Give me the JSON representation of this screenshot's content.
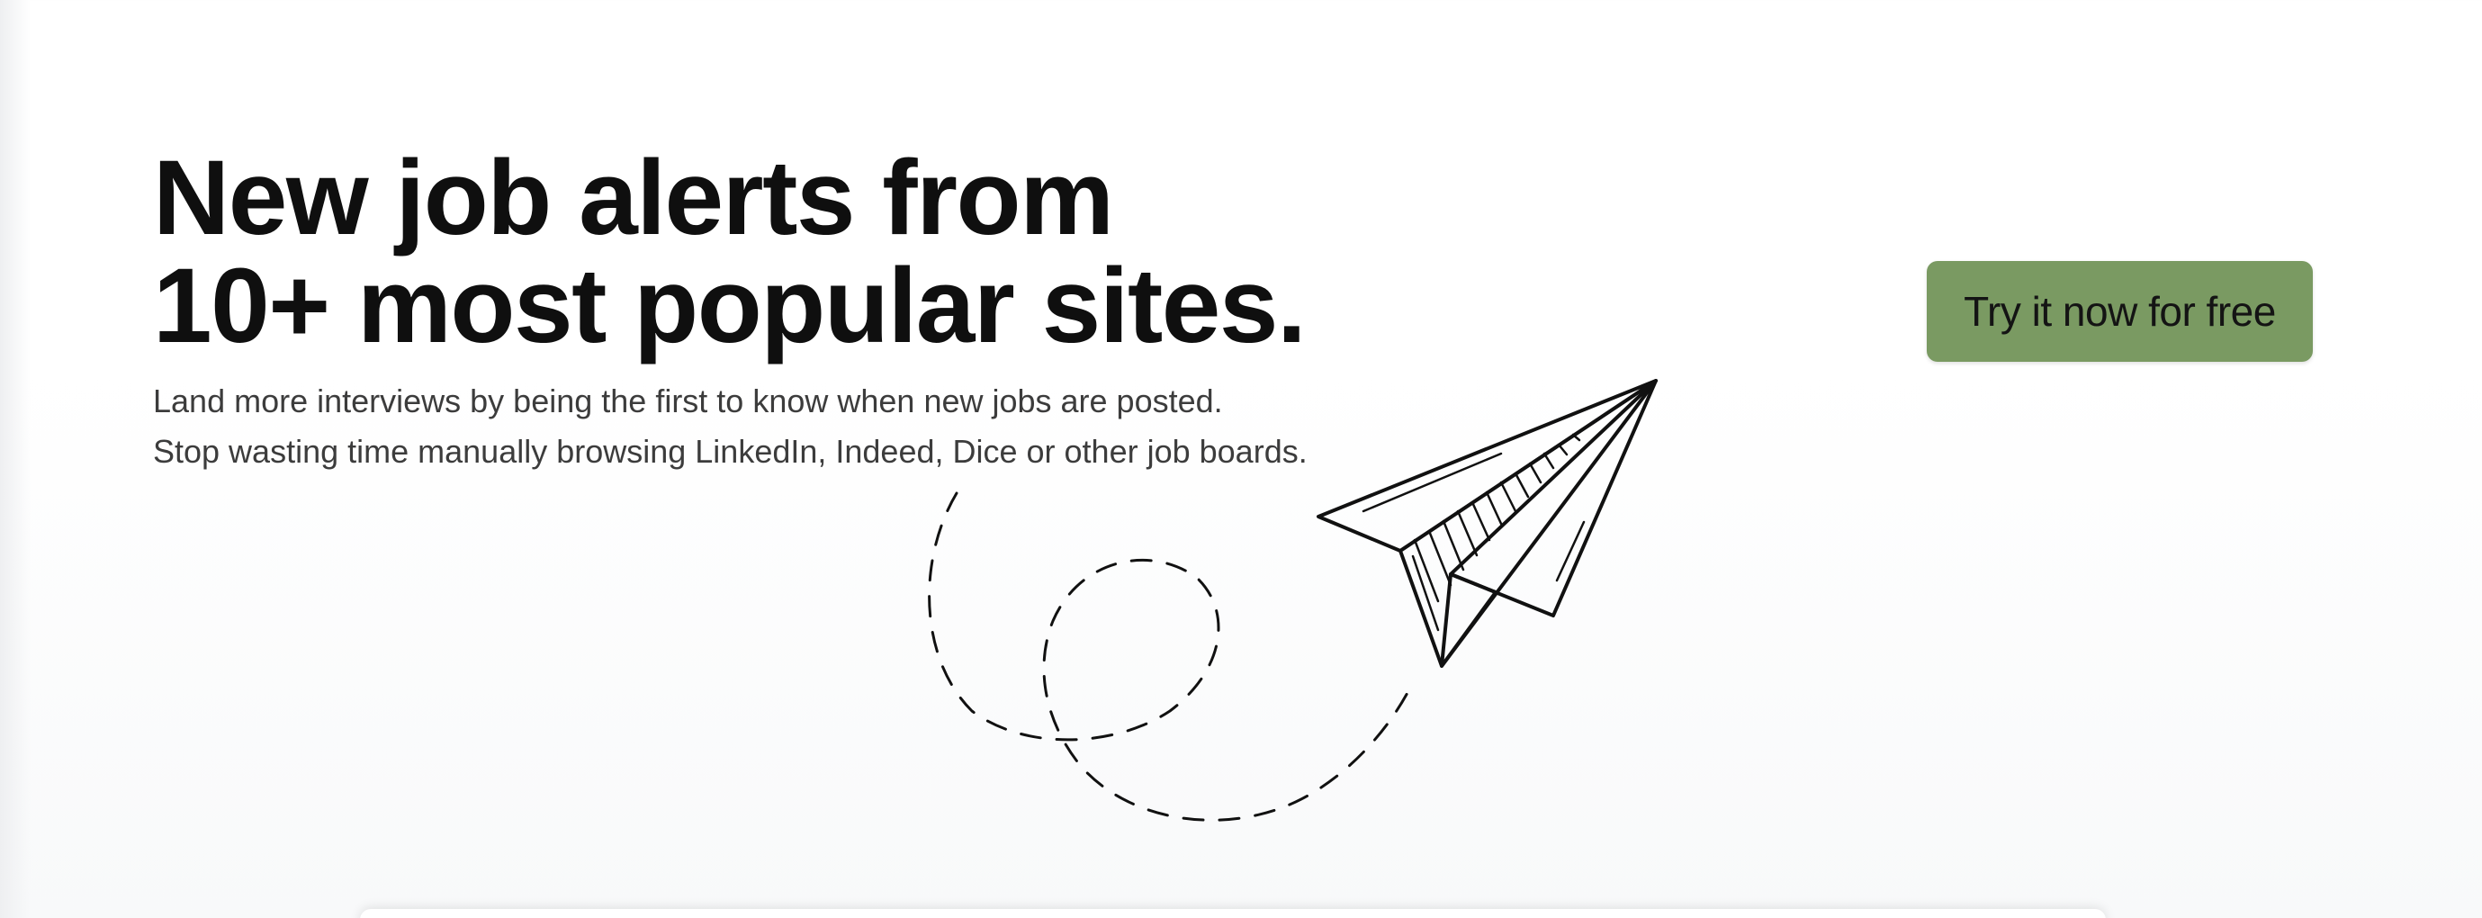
{
  "hero": {
    "headline_line1": "New job alerts from",
    "headline_line2": "10+ most popular sites.",
    "subtext_line1": "Land more interviews by being the first to know when new jobs are posted.",
    "subtext_line2": "Stop wasting time manually browsing LinkedIn, Indeed, Dice or other job boards."
  },
  "cta": {
    "label": "Try it now for free",
    "color": "#7a9a62"
  },
  "illustration": {
    "icon": "paper-plane-icon"
  }
}
